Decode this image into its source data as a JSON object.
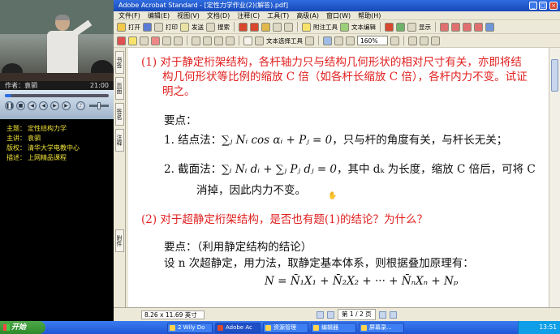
{
  "player": {
    "author_label": "作者：",
    "author_name": "袁驷",
    "time": "21:00",
    "info": [
      {
        "key": "主题：",
        "value": "定性结构力学"
      },
      {
        "key": "主讲：",
        "value": "袁驷"
      },
      {
        "key": "版权：",
        "value": "清华大学电教中心"
      },
      {
        "key": "描述：",
        "value": "上网精品课程"
      }
    ],
    "seek_fraction": 0.06
  },
  "acrobat": {
    "title": "Adobe Acrobat Standard - [定性力学作业(2)(解答).pdf]",
    "menu": [
      "文件(F)",
      "编辑(E)",
      "视图(V)",
      "文档(D)",
      "注释(C)",
      "工具(T)",
      "高级(A)",
      "窗口(W)",
      "帮助(H)"
    ],
    "toolbar1": {
      "open": "打开",
      "print": "打印",
      "send": "发送",
      "search": "搜索",
      "attach": "附注工具",
      "text_edit": "文本编辑",
      "display": "显示"
    },
    "toolbar2": {
      "select_text": "文本选择工具",
      "zoom": "160%"
    },
    "sidebar_tabs": [
      "书签",
      "页面",
      "签名",
      "注释",
      "附件"
    ],
    "page_size": "8.26 x 11.69 英寸",
    "page_indicator": "第 1 / 2 页"
  },
  "document": {
    "q1_a": "(1) 对于静定桁架结构，各杆轴力只与结构几何形状的相对尺寸有关，亦即将结",
    "q1_b": "构几何形状等比例的缩放 C 倍（如各杆长缩放 C 倍），各杆内力不变。试证",
    "q1_c": "明之。",
    "key_points": "要点：",
    "p1_label": "1.  结点法：",
    "p1_formula": "∑ⱼ Nᵢ cos αᵢ + Pⱼ = 0",
    "p1_text": "，只与杆的角度有关，与杆长无关；",
    "p2_label": "2.  截面法：",
    "p2_formula": "∑ᵢ Nᵢ dᵢ + ∑ⱼ Pⱼ dⱼ = 0",
    "p2_text": "，其中 dₖ 为长度，缩放 C 倍后，可将 C",
    "p2_cont": "消掉，因此内力不变。",
    "q2": "(2) 对于超静定桁架结构，是否也有题(1)的结论？为什么？",
    "q2_key": "要点：（利用静定结构的结论）",
    "q2_text": "设 n 次超静定，用力法，取静定基本体系，则根据叠加原理有：",
    "q2_formula": "N = N̄₁X₁ + N̄₂X₂ + ··· + N̄ₙXₙ + Nₚ"
  },
  "taskbar": {
    "start": "开始",
    "tasks": [
      "2 Wily Do",
      "Adobe Ac",
      "资源管理",
      "编辑器",
      "屏幕录..."
    ],
    "clock": "13:51"
  }
}
